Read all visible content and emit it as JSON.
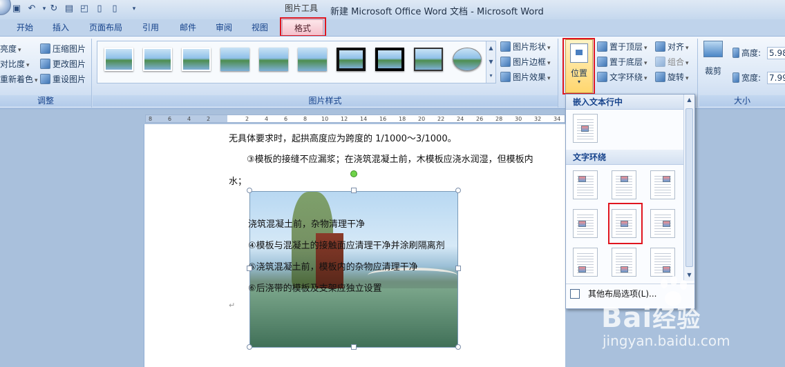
{
  "window": {
    "context_label": "图片工具",
    "title": "新建 Microsoft Office Word 文档 - Microsoft Word"
  },
  "tabs": [
    {
      "label": "开始"
    },
    {
      "label": "插入"
    },
    {
      "label": "页面布局"
    },
    {
      "label": "引用"
    },
    {
      "label": "邮件"
    },
    {
      "label": "审阅"
    },
    {
      "label": "视图"
    },
    {
      "label": "格式",
      "active": true
    }
  ],
  "ribbon": {
    "adjust": {
      "label": "调整",
      "brightness": "亮度",
      "contrast": "对比度",
      "recolor": "重新着色",
      "compress": "压缩图片",
      "change": "更改图片",
      "reset": "重设图片"
    },
    "styles": {
      "label": "图片样式",
      "shape": "图片形状",
      "border": "图片边框",
      "effects": "图片效果"
    },
    "arrange": {
      "position": "位置",
      "front": "置于顶层",
      "back": "置于底层",
      "wrap": "文字环绕",
      "align": "对齐",
      "group": "组合",
      "rotate": "旋转"
    },
    "size": {
      "label": "大小",
      "crop": "裁剪",
      "height_label": "高度:",
      "height_value": "5.98",
      "width_label": "宽度:",
      "width_value": "7.99"
    }
  },
  "ruler": {
    "ticks": [
      "8",
      "6",
      "4",
      "2",
      "2",
      "4",
      "6",
      "8",
      "10",
      "12",
      "14",
      "16",
      "18",
      "20",
      "22",
      "24",
      "26",
      "28",
      "30",
      "32",
      "34"
    ]
  },
  "document": {
    "line1": "无具体要求时，起拱高度应为跨度的 1/1000～3/1000。",
    "line2": "③模板的接缝不应漏浆；在浇筑混凝土前，木模板应浇水润湿，但模板内",
    "line3": "水；",
    "overlay": [
      "浇筑混凝土前，杂物清理干净",
      "④模板与混凝土的接触面应清理干净并涂刷隔离剂",
      "⑤浇筑混凝土前，模板内的杂物应清理干净",
      "⑥后浇带的模板及支架应独立设置"
    ],
    "para_mark": "↵"
  },
  "dropdown": {
    "inline_header": "嵌入文本行中",
    "wrap_header": "文字环绕",
    "more_options": "其他布局选项(L)..."
  },
  "watermark": {
    "brand": "Bai",
    "brand_cn": "经验",
    "url": "jingyan.baidu.com"
  }
}
